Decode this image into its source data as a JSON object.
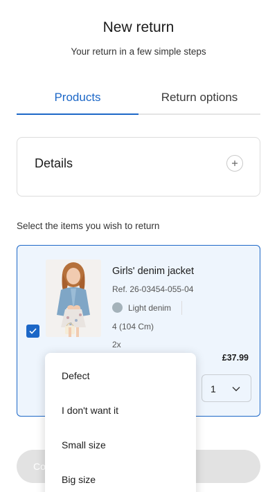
{
  "header": {
    "title": "New return",
    "subtitle": "Your return in a few simple steps"
  },
  "tabs": [
    {
      "label": "Products",
      "active": true
    },
    {
      "label": "Return options",
      "active": false
    }
  ],
  "details": {
    "label": "Details",
    "expand_icon": "plus-icon"
  },
  "prompt": "Select the items you wish to return",
  "item": {
    "selected": true,
    "name": "Girls' denim jacket",
    "ref": "Ref. 26-03454-055-04",
    "color_name": "Light denim",
    "color_hex": "#a4b2ba",
    "size": "4 (104 Cm)",
    "quantity_text": "2x",
    "price": "£37.99",
    "return_quantity": "1"
  },
  "continue_button": {
    "label": "Co"
  },
  "reason_dropdown": {
    "options": [
      "Defect",
      "I don't want it",
      "Small size",
      "Big size"
    ]
  },
  "colors": {
    "accent": "#1c67c7",
    "card_bg": "#eef5fd"
  }
}
